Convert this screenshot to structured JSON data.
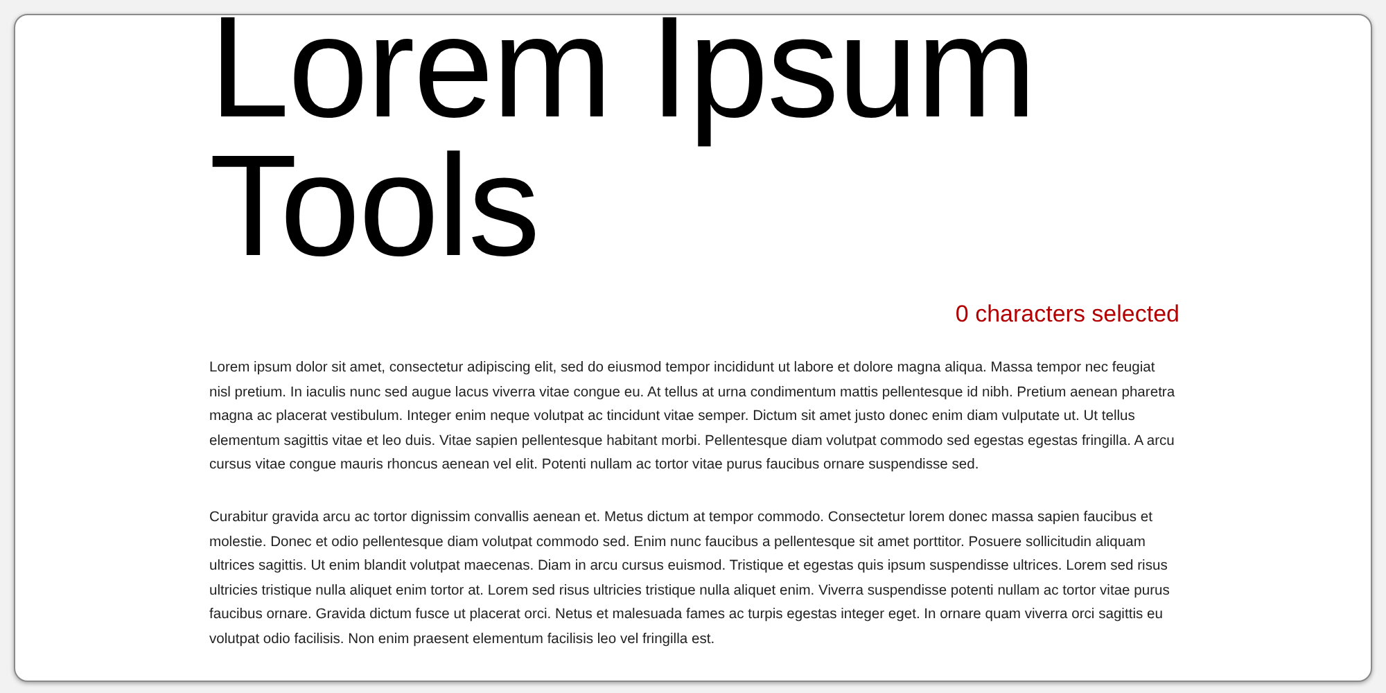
{
  "title": [
    "Lorem Ipsum",
    "Tools"
  ],
  "selection_count": "0 characters selected",
  "paragraphs": [
    "Lorem ipsum dolor sit amet, consectetur adipiscing elit, sed do eiusmod tempor incididunt ut labore et dolore magna aliqua. Massa tempor nec feugiat nisl pretium. In iaculis nunc sed augue lacus viverra vitae congue eu. At tellus at urna condimentum mattis pellentesque id nibh. Pretium aenean pharetra magna ac placerat vestibulum. Integer enim neque volutpat ac tincidunt vitae semper. Dictum sit amet justo donec enim diam vulputate ut. Ut tellus elementum sagittis vitae et leo duis. Vitae sapien pellentesque habitant morbi. Pellentesque diam volutpat commodo sed egestas egestas fringilla. A arcu cursus vitae congue mauris rhoncus aenean vel elit. Potenti nullam ac tortor vitae purus faucibus ornare suspendisse sed.",
    "Curabitur gravida arcu ac tortor dignissim convallis aenean et. Metus dictum at tempor commodo. Consectetur lorem donec massa sapien faucibus et molestie. Donec et odio pellentesque diam volutpat commodo sed. Enim nunc faucibus a pellentesque sit amet porttitor. Posuere sollicitudin aliquam ultrices sagittis. Ut enim blandit volutpat maecenas. Diam in arcu cursus euismod. Tristique et egestas quis ipsum suspendisse ultrices. Lorem sed risus ultricies tristique nulla aliquet enim tortor at. Lorem sed risus ultricies tristique nulla aliquet enim. Viverra suspendisse potenti nullam ac tortor vitae purus faucibus ornare. Gravida dictum fusce ut placerat orci. Netus et malesuada fames ac turpis egestas integer eget. In ornare quam viverra orci sagittis eu volutpat odio facilisis. Non enim praesent elementum facilisis leo vel fringilla est."
  ]
}
